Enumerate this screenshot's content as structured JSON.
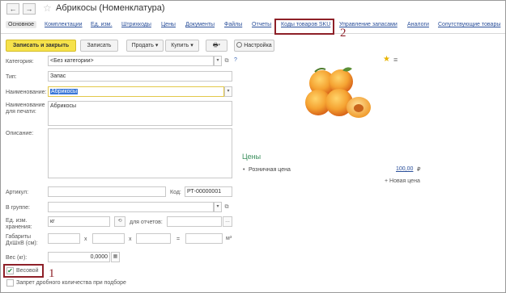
{
  "window": {
    "title": "Абрикосы (Номенклатура)",
    "back_glyph": "←",
    "forward_glyph": "→",
    "favorite_glyph": "☆"
  },
  "tabs": [
    {
      "label": "Основное"
    },
    {
      "label": "Комплектации"
    },
    {
      "label": "Ед. изм."
    },
    {
      "label": "Штрихкоды"
    },
    {
      "label": "Цены"
    },
    {
      "label": "Документы"
    },
    {
      "label": "Файлы"
    },
    {
      "label": "Отчеты"
    },
    {
      "label": "Коды товаров SKU"
    },
    {
      "label": "Управление запасами"
    },
    {
      "label": "Аналоги"
    },
    {
      "label": "Сопутствующие товары"
    }
  ],
  "toolbar": {
    "save_close": "Записать и закрыть",
    "save": "Записать",
    "sell": "Продать",
    "buy": "Купить",
    "print_glyph": "🖶",
    "settings": "Настройка",
    "caret": "▾"
  },
  "form": {
    "category": {
      "label": "Категория:",
      "value": "<Без категории>"
    },
    "type": {
      "label": "Тип:",
      "value": "Запас"
    },
    "name": {
      "label": "Наименование:",
      "value": "Абрикосы"
    },
    "print_name": {
      "label": "Наименование для печати:",
      "value": "Абрикосы"
    },
    "description": {
      "label": "Описание:",
      "value": ""
    },
    "article": {
      "label": "Артикул:",
      "value": ""
    },
    "code": {
      "label": "Код:",
      "value": "РТ-00000001"
    },
    "group": {
      "label": "В группе:",
      "value": ""
    },
    "storage_unit": {
      "label": "Ед. изм. хранения:",
      "value": "кг"
    },
    "report_unit": {
      "label": "для отчетов:",
      "value": ""
    },
    "dimensions": {
      "label": "Габариты ДхШхВ (см):",
      "x1": "x",
      "x2": "x",
      "eq": "=",
      "unit": "м³"
    },
    "weight": {
      "label": "Вес (кг):",
      "value": "0,0000"
    },
    "weighted": {
      "label": "Весовой",
      "checked": true
    },
    "fractional_ban": {
      "label": "Запрет дробного количества при подборе",
      "checked": false
    }
  },
  "right_panel": {
    "image_alt": "apricots-image",
    "prices_title": "Цены",
    "retail_price_label": "Розничная цена",
    "retail_price_value": "100,00",
    "currency": "₽",
    "new_price_link": "+ Новая цена"
  },
  "annotations": {
    "one": "1",
    "two": "2"
  },
  "colors": {
    "accent_yellow": "#f6e24b",
    "link_blue": "#2a4f9a",
    "prices_green": "#3a8f5c",
    "annotation_red": "#8e2028"
  }
}
